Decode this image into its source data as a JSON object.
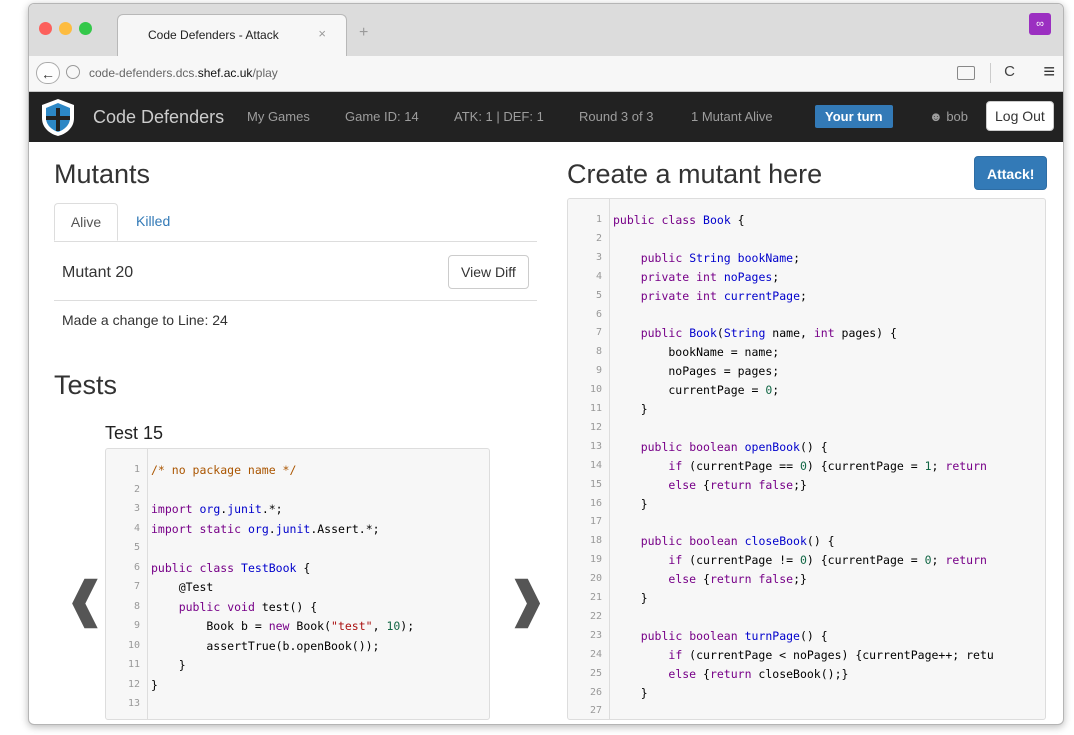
{
  "browser": {
    "tab_title": "Code Defenders - Attack",
    "tab_close": "×",
    "new_tab": "+",
    "url_prefix": "code-defenders.dcs.",
    "url_domain": "shef.ac.uk",
    "url_path": "/play",
    "back_glyph": "←",
    "reload_glyph": "C",
    "menu_glyph": "≡",
    "extension_glyph": "∞",
    "traffic_colors": [
      "#fc605c",
      "#fdbc40",
      "#34c84a"
    ]
  },
  "navbar": {
    "brand": "Code Defenders",
    "my_games": "My Games",
    "game_id": "Game ID: 14",
    "score": "ATK: 1 | DEF: 1",
    "round": "Round 3 of 3",
    "mutants_alive": "1 Mutant Alive",
    "your_turn": "Your turn",
    "user": "bob",
    "logout": "Log Out"
  },
  "left": {
    "mutants_heading": "Mutants",
    "tab_alive": "Alive",
    "tab_killed": "Killed",
    "mutant_title": "Mutant 20",
    "view_diff": "View Diff",
    "mutant_desc": "Made a change to Line: 24",
    "tests_heading": "Tests",
    "test_title": "Test 15",
    "prev_arrow": "❰",
    "next_arrow": "❱"
  },
  "test_code": [
    "/* no package name */",
    "",
    "import org.junit.*;",
    "import static org.junit.Assert.*;",
    "",
    "public class TestBook {",
    "    @Test",
    "    public void test() {",
    "        Book b = new Book(\"test\", 10);",
    "        assertTrue(b.openBook());",
    "    }",
    "}",
    ""
  ],
  "right": {
    "heading": "Create a mutant here",
    "attack_button": "Attack!"
  },
  "mutant_code": [
    "public class Book {",
    "",
    "    public String bookName;",
    "    private int noPages;",
    "    private int currentPage;",
    "",
    "    public Book(String name, int pages) {",
    "        bookName = name;",
    "        noPages = pages;",
    "        currentPage = 0;",
    "    }",
    "",
    "    public boolean openBook() {",
    "        if (currentPage == 0) {currentPage = 1; return",
    "        else {return false;}",
    "    }",
    "",
    "    public boolean closeBook() {",
    "        if (currentPage != 0) {currentPage = 0; return",
    "        else {return false;}",
    "    }",
    "",
    "    public boolean turnPage() {",
    "        if (currentPage < noPages) {currentPage++; retu",
    "        else {return closeBook();}",
    "    }",
    ""
  ],
  "colors": {
    "navbar_bg": "#222222",
    "primary": "#337ab7",
    "keyword": "#770088",
    "type": "#0000cc",
    "string": "#aa1111",
    "number": "#116644",
    "comment": "#aa5500"
  }
}
